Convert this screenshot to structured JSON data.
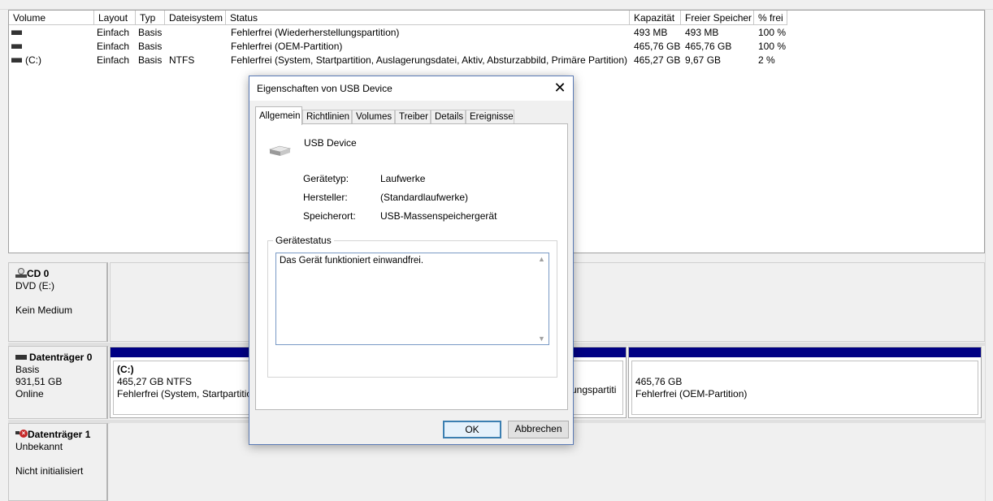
{
  "volume_list": {
    "columns": [
      "Volume",
      "Layout",
      "Typ",
      "Dateisystem",
      "Status",
      "Kapazität",
      "Freier Speicher",
      "% frei"
    ],
    "rows": [
      {
        "volume": "",
        "layout": "Einfach",
        "typ": "Basis",
        "dateisystem": "",
        "status": "Fehlerfrei (Wiederherstellungspartition)",
        "kapazitaet": "493 MB",
        "frei": "493 MB",
        "prozent": "100 %"
      },
      {
        "volume": "",
        "layout": "Einfach",
        "typ": "Basis",
        "dateisystem": "",
        "status": "Fehlerfrei (OEM-Partition)",
        "kapazitaet": "465,76 GB",
        "frei": "465,76 GB",
        "prozent": "100 %"
      },
      {
        "volume": "(C:)",
        "layout": "Einfach",
        "typ": "Basis",
        "dateisystem": "NTFS",
        "status": "Fehlerfrei (System, Startpartition, Auslagerungsdatei, Aktiv, Absturzabbild, Primäre Partition)",
        "kapazitaet": "465,27 GB",
        "frei": "9,67 GB",
        "prozent": "2 %"
      }
    ]
  },
  "disks": {
    "cd0": {
      "name": "CD 0",
      "line1": "DVD (E:)",
      "line2": "Kein Medium",
      "icon": "cd-drive-icon"
    },
    "disk0": {
      "name": "Datenträger 0",
      "line1": "Basis",
      "line2": "931,51 GB",
      "line3": "Online",
      "icon": "disk-icon",
      "partition_c": {
        "label": "(C:)",
        "size": "465,27 GB NTFS",
        "status": "Fehlerfrei (System, Startpartition"
      },
      "partition_mid_status": "ungspartiti",
      "partition_oem": {
        "size": "465,76 GB",
        "status": "Fehlerfrei (OEM-Partition)"
      }
    },
    "disk1": {
      "name": "Datenträger 1",
      "line1": "Unbekannt",
      "line2": "Nicht initialisiert",
      "icon": "disk-error-icon"
    }
  },
  "dialog": {
    "title": "Eigenschaften von USB Device",
    "tabs": [
      "Allgemein",
      "Richtlinien",
      "Volumes",
      "Treiber",
      "Details",
      "Ereignisse"
    ],
    "active_tab": "Allgemein",
    "device_name": "USB Device",
    "fields": [
      {
        "label": "Gerätetyp:",
        "value": "Laufwerke"
      },
      {
        "label": "Hersteller:",
        "value": "(Standardlaufwerke)"
      },
      {
        "label": "Speicherort:",
        "value": "USB-Massenspeichergerät"
      }
    ],
    "status_group_label": "Gerätestatus",
    "status_text": "Das Gerät funktioniert einwandfrei.",
    "ok_label": "OK",
    "cancel_label": "Abbrechen"
  },
  "colors": {
    "partition_bar": "#000084",
    "dialog_border": "#5a7ab5"
  }
}
